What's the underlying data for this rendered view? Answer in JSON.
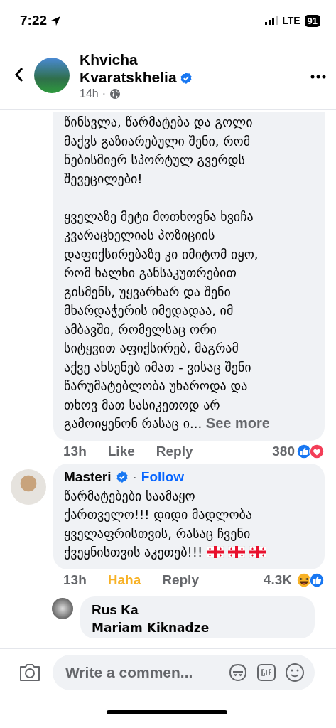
{
  "status_bar": {
    "time": "7:22",
    "network": "LTE",
    "battery": "91"
  },
  "header": {
    "name": "Khvicha Kvaratskhelia",
    "verified": true,
    "separator": "·",
    "time": "14h"
  },
  "comments": [
    {
      "kind": "comment",
      "text": "წინსვლა, წარმატება და გოლი\nმაქვს გაზიარებული შენი, რომ\nნებისმიერ სპორტულ გვერდს\nშევეცილები!\n\nყველაზე მეტი მოთხოვნა ხვიჩა\nკვარაცხელიას პოზიციის\nდაფიქსირებაზე კი იმიტომ იყო,\nრომ ხალხი განსაკუთრებით\nგისმენს, უყვარხარ და შენი\nმხარდაჭერის იმედადაა, იმ\nამბავში, რომელსაც ორი\nსიტყვით აფიქსირებ, მაგრამ\nაქვე ახსენებ იმათ - ვისაც შენი\nწარუმატებლობა უხაროდა და\nთხოვ მათ სასიკეთოდ არ\nგამოიყენონ რასაც ი...",
      "see_more": "See more",
      "time": "13h",
      "actions": [
        {
          "label": "Like",
          "selected": false
        },
        {
          "label": "Reply",
          "selected": false
        }
      ],
      "reaction_count": "380",
      "reactions": [
        {
          "kind": "like"
        },
        {
          "kind": "love"
        }
      ]
    },
    {
      "kind": "comment",
      "author": "Masteri",
      "verified": true,
      "separator": "·",
      "follow": "Follow",
      "text": "წარმატებები საამაყო\nქართველო!!! დიდი მადლობა\nყველაფრისთვის, რასაც ჩვენი\nქვეყნისთვის აკეთებ!!!",
      "emoji": [
        {
          "kind": "georgian-flag"
        },
        {
          "kind": "georgian-flag"
        },
        {
          "kind": "georgian-flag"
        }
      ],
      "time": "13h",
      "actions": [
        {
          "label": "Haha",
          "selected": true
        },
        {
          "label": "Reply",
          "selected": false
        }
      ],
      "reaction_count": "4.3K",
      "reactions": [
        {
          "kind": "haha"
        },
        {
          "kind": "like"
        }
      ]
    },
    {
      "kind": "reply",
      "author": "Rus Ka",
      "verified": false,
      "text": "Mariam Kiknadze"
    }
  ],
  "composer": {
    "placeholder": "Write a commen..."
  }
}
